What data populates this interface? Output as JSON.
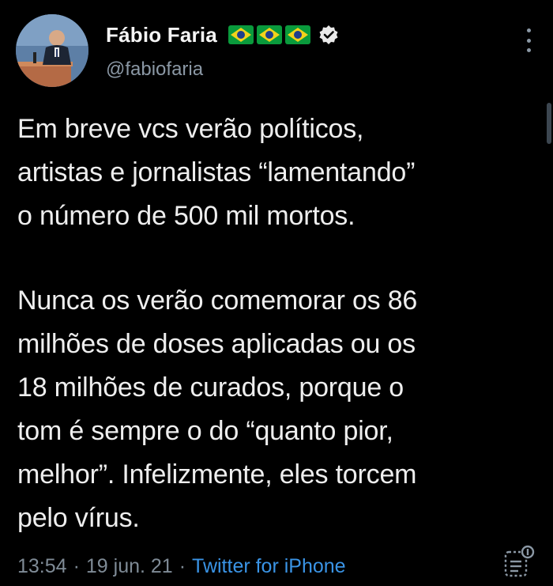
{
  "author": {
    "name": "Fábio Faria",
    "handle": "@fabiofaria",
    "flag_icon": "brazil-flag-icon",
    "flag_count": 3,
    "verified": true
  },
  "tweet": {
    "text_lines_p1": [
      "Em breve vcs verão políticos,",
      "artistas e jornalistas “lamentando”",
      "o número de 500 mil mortos."
    ],
    "text_lines_p2": [
      "Nunca os verão comemorar os 86",
      "milhões de doses aplicadas ou os",
      "18 milhões de curados, porque o",
      "tom é sempre o do “quanto pior,",
      "melhor”.  Infelizmente, eles torcem",
      "pelo vírus."
    ]
  },
  "meta": {
    "time": "13:54",
    "separator": "·",
    "date": "19 jun. 21",
    "source": "Twitter for iPhone"
  },
  "colors": {
    "background": "#000000",
    "text": "#eeeeee",
    "muted": "#7f8b96",
    "link": "#3a94e6",
    "flag_green": "#0a9a3c",
    "flag_yellow": "#f2d21b",
    "flag_blue": "#1f3e8c"
  }
}
